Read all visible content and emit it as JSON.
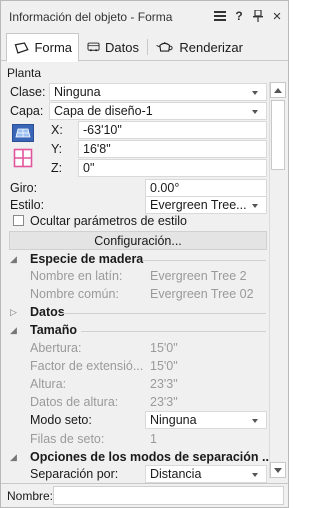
{
  "window": {
    "title": "Información del objeto - Forma",
    "menu_icon": "hamburger-menu-icon",
    "help_label": "?",
    "pin_icon": "pin-icon",
    "close_label": "×"
  },
  "tabs": [
    {
      "label": "Forma",
      "icon": "shape-icon",
      "active": true
    },
    {
      "label": "Datos",
      "icon": "data-icon",
      "active": false
    },
    {
      "label": "Renderizar",
      "icon": "render-teapot-icon",
      "active": false
    }
  ],
  "section": {
    "title": "Planta"
  },
  "clase": {
    "label": "Clase:",
    "value": "Ninguna"
  },
  "capa": {
    "label": "Capa:",
    "value": "Capa de diseño-1"
  },
  "coords": {
    "x_label": "X:",
    "x_value": "-63'10\"",
    "y_label": "Y:",
    "y_value": "16'8\"",
    "z_label": "Z:",
    "z_value": "0\""
  },
  "giro": {
    "label": "Giro:",
    "value": "0.00°"
  },
  "estilo": {
    "label": "Estilo:",
    "value": "Evergreen Tree..."
  },
  "ocultar": {
    "label": "Ocultar parámetros de estilo",
    "checked": false
  },
  "config_button": "Configuración...",
  "groups": {
    "especie": {
      "title": "Especie de madera",
      "items": [
        {
          "label": "Nombre en latín:",
          "value": "Evergreen Tree 2"
        },
        {
          "label": "Nombre común:",
          "value": "Evergreen Tree 02"
        }
      ]
    },
    "datos": {
      "title": "Datos"
    },
    "tamano": {
      "title": "Tamaño",
      "abertura": {
        "label": "Abertura:",
        "value": "15'0\""
      },
      "factor": {
        "label": "Factor de extensió...",
        "value": "15'0\""
      },
      "altura": {
        "label": "Altura:",
        "value": "23'3\""
      },
      "datos_altura": {
        "label": "Datos de altura:",
        "value": "23'3\""
      },
      "modo_seto": {
        "label": "Modo seto:",
        "value": "Ninguna"
      },
      "filas_seto": {
        "label": "Filas de seto:",
        "value": "1"
      }
    },
    "opciones": {
      "title": "Opciones de los modos de separación ...",
      "separacion": {
        "label": "Separación por:",
        "value": "Distancia"
      }
    }
  },
  "nombre": {
    "label": "Nombre:",
    "value": ""
  }
}
